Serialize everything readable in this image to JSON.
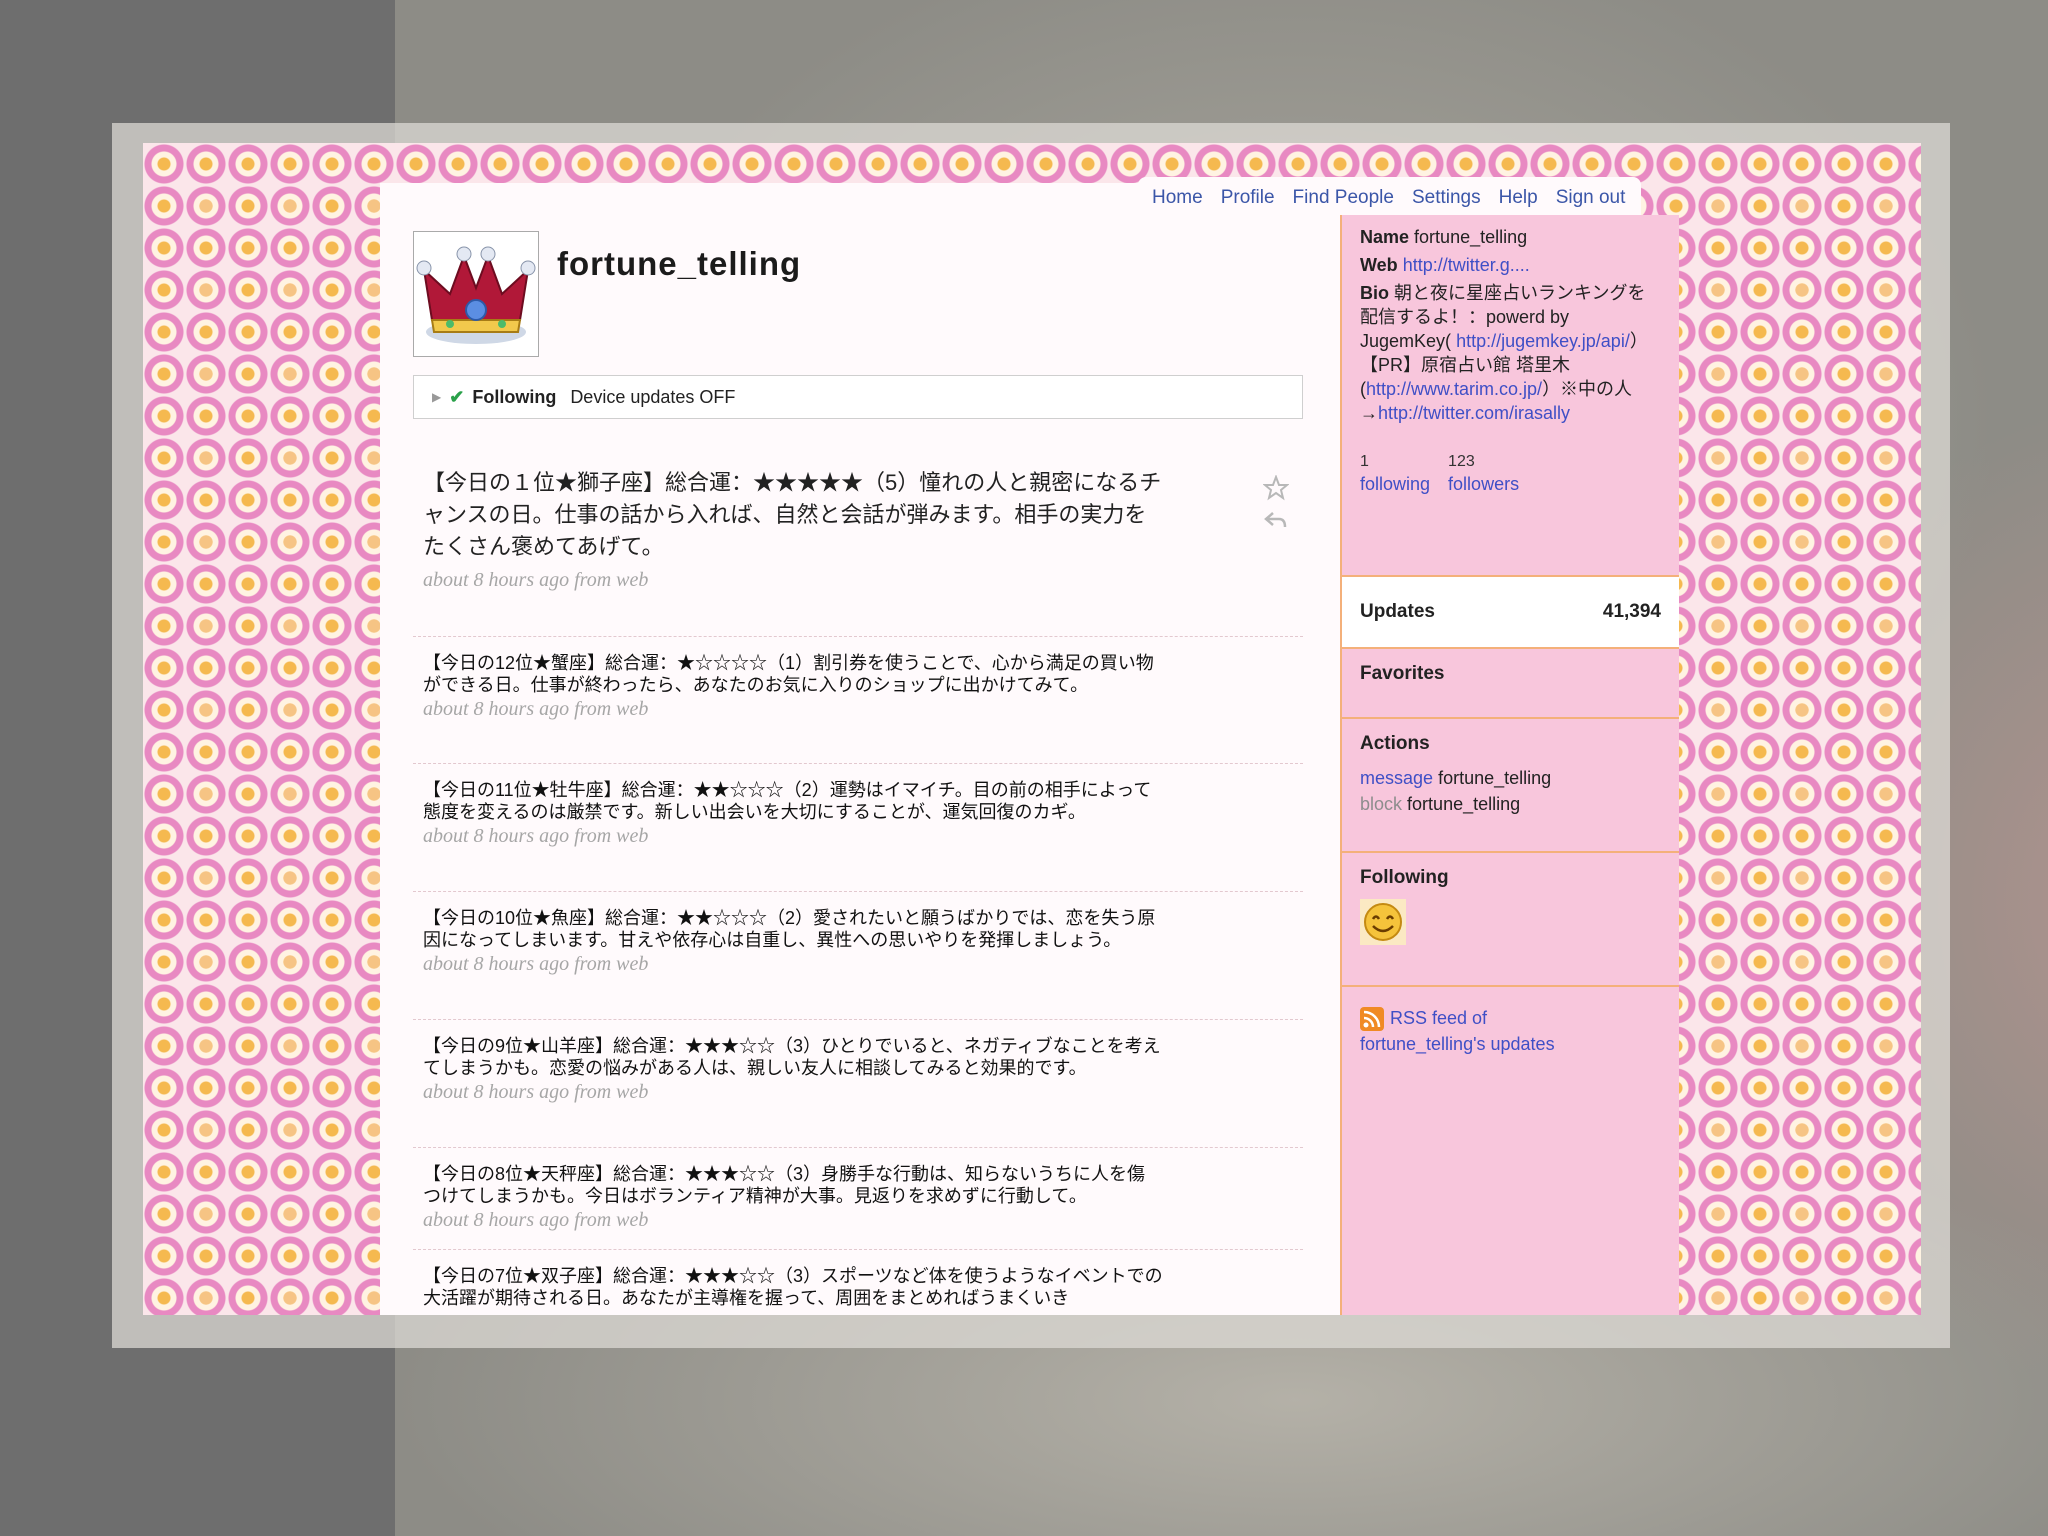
{
  "nav": {
    "items": [
      "Home",
      "Profile",
      "Find People",
      "Settings",
      "Help",
      "Sign out"
    ]
  },
  "profile": {
    "screen_name": "fortune_telling",
    "following_label": "Following",
    "device_updates": "Device updates OFF"
  },
  "latest": {
    "text": "【今日の１位★獅子座】総合運：★★★★★（5）憧れの人と親密になるチャンスの日。仕事の話から入れば、自然と会話が弾みます。相手の実力をたくさん褒めてあげて。",
    "meta": "about 8 hours ago from web"
  },
  "tweets": [
    {
      "text": "【今日の12位★蟹座】総合運：★☆☆☆☆（1）割引券を使うことで、心から満足の買い物ができる日。仕事が終わったら、あなたのお気に入りのショップに出かけてみて。",
      "meta": "about 8 hours ago from web"
    },
    {
      "text": "【今日の11位★牡牛座】総合運：★★☆☆☆（2）運勢はイマイチ。目の前の相手によって態度を変えるのは厳禁です。新しい出会いを大切にすることが、運気回復のカギ。",
      "meta": "about 8 hours ago from web"
    },
    {
      "text": "【今日の10位★魚座】総合運：★★☆☆☆（2）愛されたいと願うばかりでは、恋を失う原因になってしまいます。甘えや依存心は自重し、異性への思いやりを発揮しましょう。",
      "meta": "about 8 hours ago from web"
    },
    {
      "text": "【今日の9位★山羊座】総合運：★★★☆☆（3）ひとりでいると、ネガティブなことを考えてしまうかも。恋愛の悩みがある人は、親しい友人に相談してみると効果的です。",
      "meta": "about 8 hours ago from web"
    },
    {
      "text": "【今日の8位★天秤座】総合運：★★★☆☆（3）身勝手な行動は、知らないうちに人を傷つけてしまうかも。今日はボランティア精神が大事。見返りを求めずに行動して。",
      "meta": "about 8 hours ago from web"
    },
    {
      "text": "【今日の7位★双子座】総合運：★★★☆☆（3）スポーツなど体を使うようなイベントでの大活躍が期待される日。あなたが主導権を握って、周囲をまとめればうまくいき",
      "meta": ""
    }
  ],
  "sidebar": {
    "name_label": "Name",
    "name_value": "fortune_telling",
    "web_label": "Web",
    "web_value": "http://twitter.g....",
    "bio_label": "Bio",
    "bio_1": "朝と夜に星座占いランキングを配信するよ！：powerd by JugemKey(",
    "bio_link_1": "http://jugemkey.jp/api/",
    "bio_2": "）【PR】原宿占い館 塔里木(",
    "bio_link_2": "http://www.tarim.co.jp/",
    "bio_3": "）※中の人→",
    "bio_link_3": "http://twitter.com/irasally",
    "following_count": "1",
    "following_label": "following",
    "followers_count": "123",
    "followers_label": "followers",
    "updates_label": "Updates",
    "updates_count": "41,394",
    "favorites_label": "Favorites",
    "actions_label": "Actions",
    "message_link": "message",
    "block_link": "block",
    "action_target": "fortune_telling",
    "following_section": "Following",
    "rss_line_1": "RSS feed of",
    "rss_line_2": "fortune_telling's updates"
  },
  "colors": {
    "link": "#3f4fc6",
    "sidebar_bg": "#f8c6dc",
    "sidebar_border": "#f4b07a",
    "meta": "#a6a6a6"
  },
  "icons": [
    "crown-avatar-icon",
    "star-icon",
    "reply-icon",
    "smiley-avatar-icon",
    "rss-icon"
  ]
}
